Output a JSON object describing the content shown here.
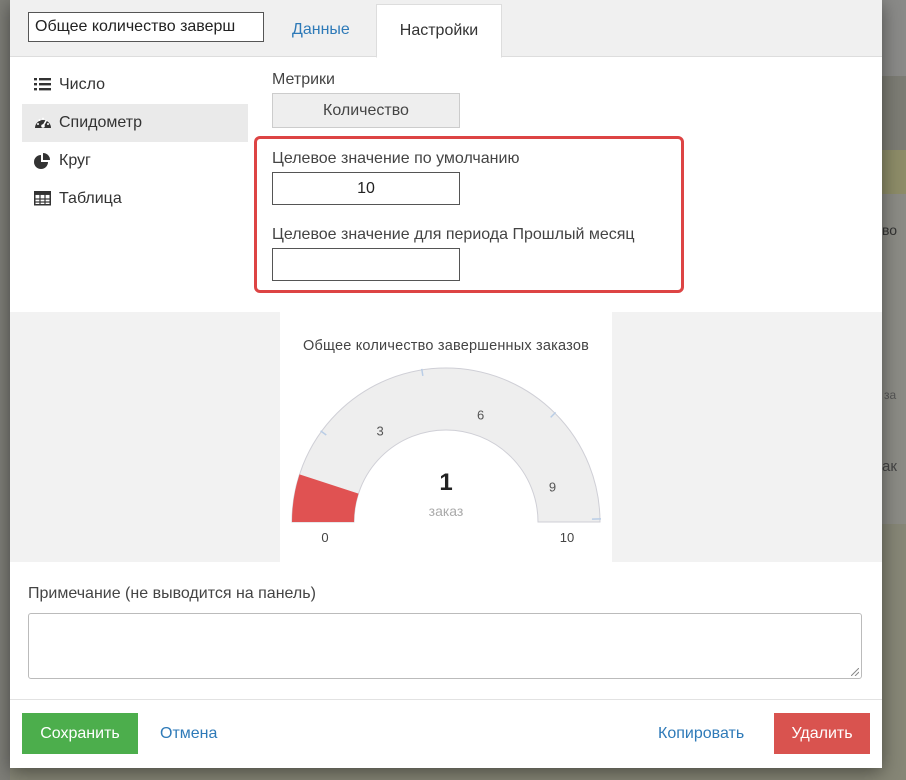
{
  "header": {
    "title_value": "Общее количество заверш",
    "tabs": [
      {
        "label": "Данные"
      },
      {
        "label": "Настройки"
      }
    ]
  },
  "sidebar": {
    "items": [
      {
        "label": "Число",
        "icon": "list-icon"
      },
      {
        "label": "Спидометр",
        "icon": "dashboard-icon",
        "active": true
      },
      {
        "label": "Круг",
        "icon": "pie-chart-icon"
      },
      {
        "label": "Таблица",
        "icon": "table-icon"
      }
    ]
  },
  "settings": {
    "metrics_label": "Метрики",
    "metrics_value": "Количество",
    "default_target_label": "Целевое значение по умолчанию",
    "default_target_value": "10",
    "period_target_label": "Целевое значение для периода Прошлый месяц",
    "period_target_value": ""
  },
  "gauge": {
    "title": "Общее количество завершенных заказов",
    "value": 1,
    "value_text": "1",
    "unit": "заказ",
    "min": 0,
    "max": 10,
    "min_label": "0",
    "max_label": "10",
    "ticks": [
      3,
      6,
      9
    ],
    "fill_color": "#e05252",
    "track_color": "#eeeeee"
  },
  "note": {
    "label": "Примечание (не выводится на панель)",
    "value": ""
  },
  "footer": {
    "save_label": "Сохранить",
    "cancel_label": "Отмена",
    "copy_label": "Копировать",
    "delete_label": "Удалить"
  },
  "colors": {
    "accent_link": "#2e7ab8",
    "save_green": "#4cae4c",
    "delete_red": "#d9534f",
    "highlight_frame": "#dd4444"
  },
  "background": {
    "side_text_1": "во",
    "side_text_2": "за",
    "side_text_3": "ак"
  }
}
